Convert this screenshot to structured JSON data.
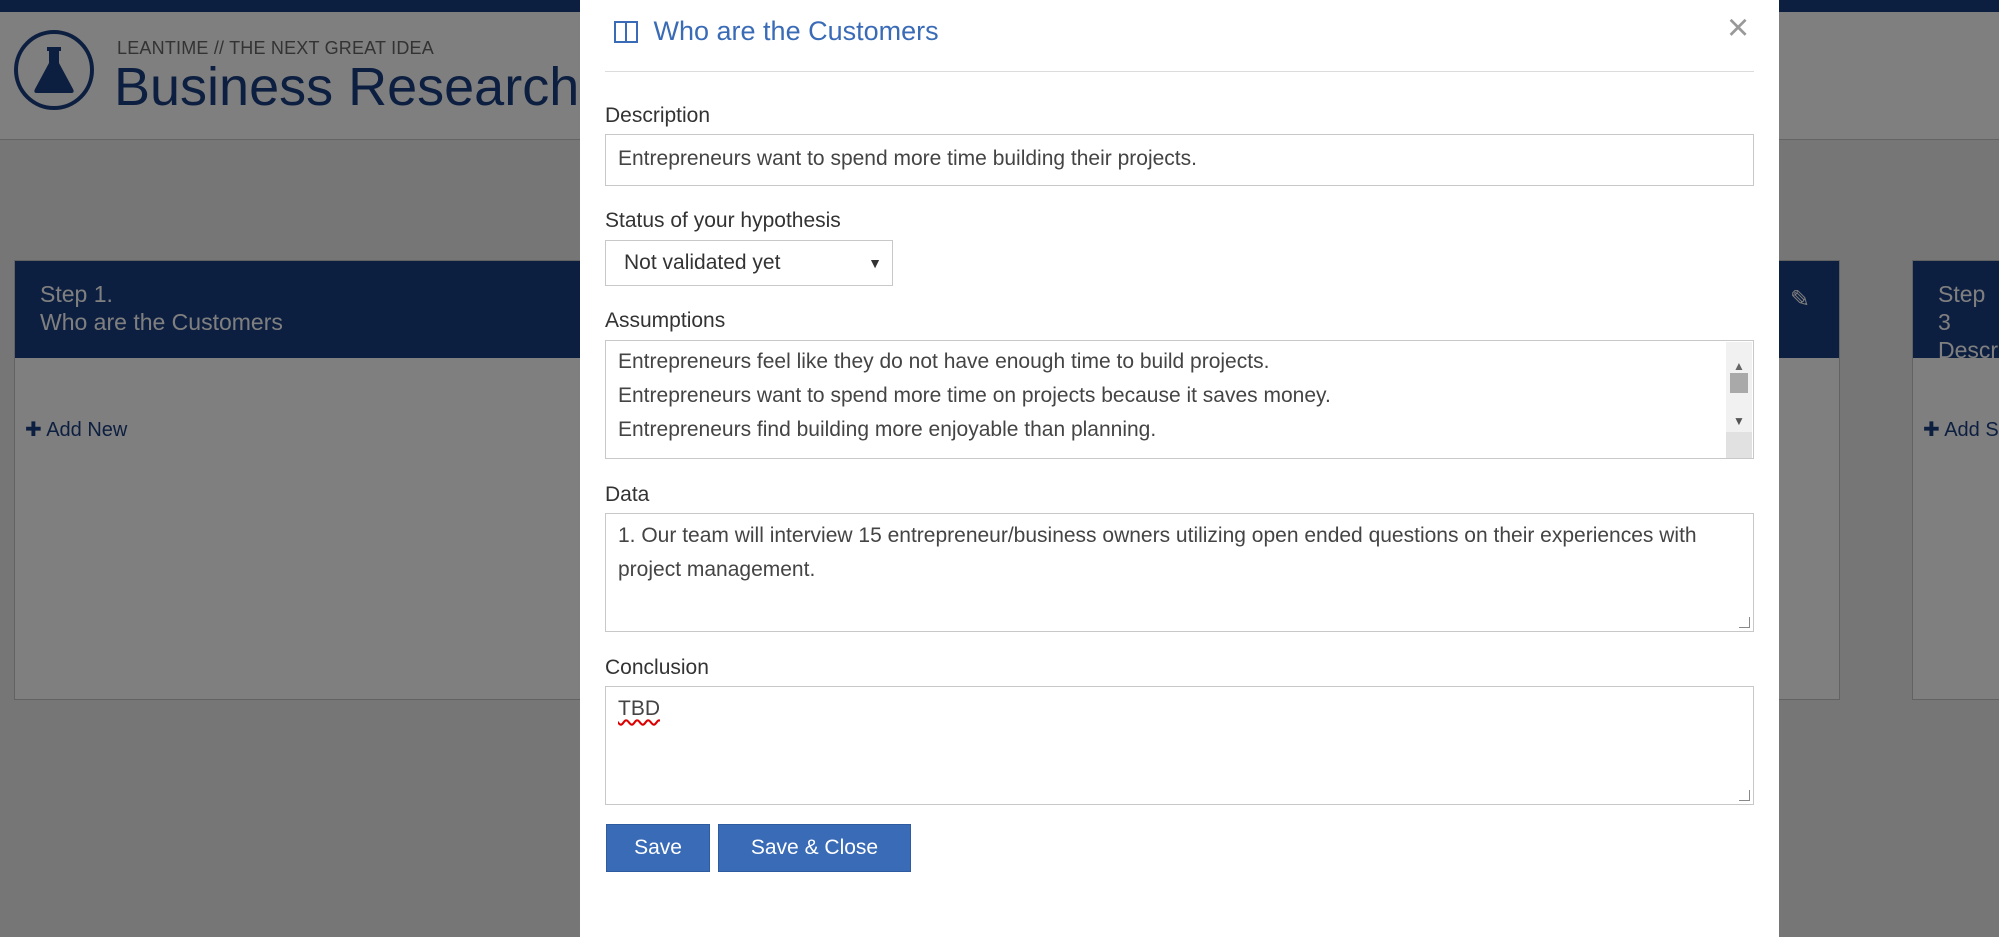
{
  "header": {
    "subtitle": "LEANTIME // THE NEXT GREAT IDEA",
    "title": "Business Research"
  },
  "board": {
    "columns": [
      {
        "step": "Step 1.",
        "name": "Who are the Customers",
        "add_label": "Add New"
      },
      {
        "step": "Step 3",
        "name": "Descr",
        "add_label": "Add S"
      }
    ]
  },
  "modal": {
    "title": "Who are the Customers",
    "close_label": "×",
    "fields": {
      "description": {
        "label": "Description",
        "value": "Entrepreneurs  want to spend more time building their projects."
      },
      "status": {
        "label": "Status of your hypothesis",
        "value": "Not validated yet"
      },
      "assumptions": {
        "label": "Assumptions",
        "lines": [
          "Entrepreneurs feel like they do not have enough time to build projects.",
          "Entrepreneurs want to spend more time on projects because it saves money.",
          "Entrepreneurs find building more enjoyable than planning."
        ]
      },
      "data": {
        "label": "Data",
        "value": "1. Our team will interview 15 entrepreneur/business owners utilizing open ended questions on their experiences with project management."
      },
      "conclusion": {
        "label": "Conclusion",
        "value": "TBD"
      }
    },
    "buttons": {
      "save": "Save",
      "save_close": "Save & Close"
    }
  },
  "colors": {
    "brand": "#1b3f80",
    "accent": "#3a6bb7"
  }
}
